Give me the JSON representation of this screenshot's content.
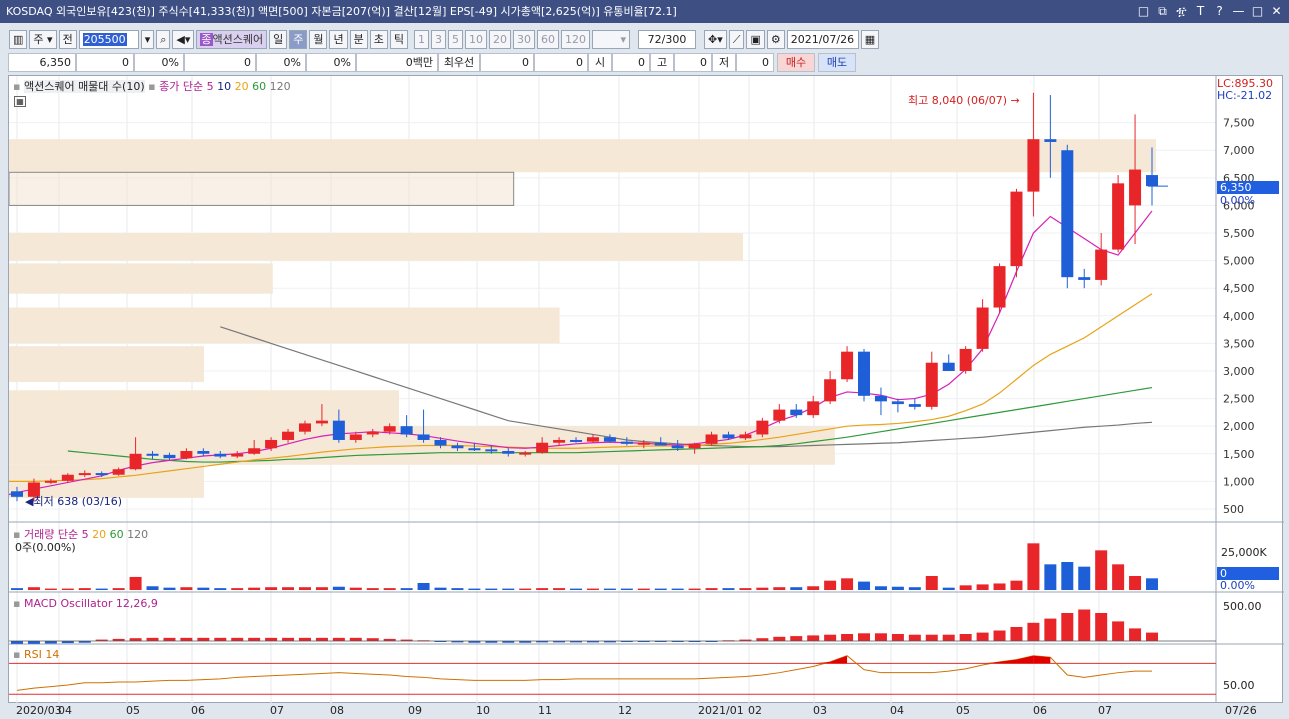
{
  "title": "KOSDAQ 외국인보유[423(천)] 주식수[41,333(천)] 액면[500] 자본금[207(억)] 결산[12월] EPS[-49] 시가총액[2,625(억)] 유통비율[72.1]",
  "window_icons": [
    "□",
    "⧉",
    "፹",
    "T",
    "?",
    "—",
    "□",
    "✕"
  ],
  "toolbar": {
    "period": "주",
    "prev": "전",
    "code": "205500",
    "name": "액션스퀘어",
    "name_icon": "종",
    "periods": [
      "일",
      "주",
      "월",
      "년",
      "분",
      "초",
      "틱"
    ],
    "selected_period": "주",
    "intervals": [
      "1",
      "3",
      "5",
      "10",
      "20",
      "30",
      "60",
      "120"
    ],
    "count": "72",
    "count_total": "/300",
    "date": "2021/07/26"
  },
  "quote": {
    "price": "6,350",
    "v1": "0",
    "p1": "0%",
    "v2": "0",
    "p2": "0%",
    "p3": "0%",
    "amount": "0백만",
    "best_label": "최우선",
    "b1": "0",
    "b2": "0",
    "open_label": "시",
    "open": "0",
    "high_label": "고",
    "high": "0",
    "low_label": "저",
    "low": "0",
    "buy": "매수",
    "sell": "매도"
  },
  "main_panel": {
    "legend_vp": "액션스퀘어 매물대 수(10)",
    "legend_ma_prefix": "종가 단순",
    "ma_periods": [
      "5",
      "10",
      "20",
      "60",
      "120"
    ],
    "lc": "LC:895.30",
    "hc": "HC:-21.02",
    "high_annot": "최고 8,040 (06/07)",
    "low_annot": "최저 638 (03/16)",
    "price_ticks": [
      "7,500",
      "7,000",
      "6,500",
      "6,000",
      "5,500",
      "5,000",
      "4,500",
      "4,000",
      "3,500",
      "3,000",
      "2,500",
      "2,000",
      "1,500",
      "1,000",
      "500"
    ],
    "current_price": "6,350",
    "current_pct": "0.00%"
  },
  "volume_panel": {
    "legend_prefix": "거래량 단순",
    "ma_periods": [
      "5",
      "20",
      "60",
      "120"
    ],
    "info": "0주(0.00%)",
    "tick": "25,000K",
    "cur": "0",
    "cur_pct": "0.00%"
  },
  "macd_panel": {
    "legend": "MACD Oscillator 12,26,9",
    "tick": "500.00"
  },
  "rsi_panel": {
    "legend": "RSI 14",
    "tick": "50.00"
  },
  "x_axis": {
    "labels": [
      "2020/03",
      "04",
      "05",
      "06",
      "07",
      "08",
      "09",
      "10",
      "11",
      "12",
      "2021/01",
      "02",
      "03",
      "04",
      "05",
      "06",
      "07"
    ],
    "end_label": "07/26"
  },
  "colors": {
    "up": "#e8262a",
    "down": "#1e5fd8",
    "ma5": "#d81fb8",
    "ma10": "#1a237e",
    "ma20": "#e8a316",
    "ma60": "#2e9a3a",
    "ma120": "#777777",
    "vp": "#f5e8d7"
  },
  "chart_data": {
    "type": "candlestick",
    "x": [
      "2020/03",
      "04",
      "05",
      "06",
      "07",
      "08",
      "09",
      "10",
      "11",
      "12",
      "2021/01",
      "02",
      "03",
      "04",
      "05",
      "06",
      "07"
    ],
    "ylim": [
      300,
      8200
    ],
    "candles": [
      [
        820,
        900,
        640,
        720
      ],
      [
        720,
        1050,
        638,
        980
      ],
      [
        980,
        1050,
        950,
        1010
      ],
      [
        1010,
        1150,
        980,
        1120
      ],
      [
        1120,
        1200,
        1080,
        1150
      ],
      [
        1150,
        1180,
        1080,
        1120
      ],
      [
        1120,
        1250,
        1100,
        1220
      ],
      [
        1220,
        1800,
        1200,
        1500
      ],
      [
        1500,
        1550,
        1400,
        1480
      ],
      [
        1480,
        1520,
        1380,
        1420
      ],
      [
        1420,
        1600,
        1400,
        1550
      ],
      [
        1550,
        1600,
        1450,
        1500
      ],
      [
        1500,
        1550,
        1420,
        1450
      ],
      [
        1450,
        1550,
        1420,
        1500
      ],
      [
        1500,
        1750,
        1480,
        1600
      ],
      [
        1600,
        1800,
        1550,
        1750
      ],
      [
        1750,
        1950,
        1700,
        1900
      ],
      [
        1900,
        2100,
        1850,
        2050
      ],
      [
        2050,
        2400,
        2000,
        2100
      ],
      [
        2100,
        2300,
        1700,
        1750
      ],
      [
        1750,
        1900,
        1700,
        1850
      ],
      [
        1850,
        1950,
        1800,
        1900
      ],
      [
        1900,
        2050,
        1850,
        2000
      ],
      [
        2000,
        2200,
        1800,
        1850
      ],
      [
        1850,
        2300,
        1700,
        1750
      ],
      [
        1750,
        1800,
        1600,
        1650
      ],
      [
        1650,
        1700,
        1550,
        1600
      ],
      [
        1600,
        1700,
        1550,
        1580
      ],
      [
        1580,
        1650,
        1500,
        1550
      ],
      [
        1550,
        1600,
        1450,
        1500
      ],
      [
        1500,
        1550,
        1450,
        1520
      ],
      [
        1520,
        1800,
        1500,
        1700
      ],
      [
        1700,
        1800,
        1650,
        1750
      ],
      [
        1750,
        1800,
        1700,
        1720
      ],
      [
        1720,
        1850,
        1700,
        1800
      ],
      [
        1800,
        1850,
        1700,
        1720
      ],
      [
        1720,
        1800,
        1650,
        1680
      ],
      [
        1680,
        1750,
        1600,
        1700
      ],
      [
        1700,
        1800,
        1650,
        1650
      ],
      [
        1650,
        1750,
        1550,
        1600
      ],
      [
        1600,
        1700,
        1500,
        1680
      ],
      [
        1680,
        1900,
        1650,
        1850
      ],
      [
        1850,
        1900,
        1750,
        1780
      ],
      [
        1780,
        1900,
        1750,
        1850
      ],
      [
        1850,
        2150,
        1800,
        2100
      ],
      [
        2100,
        2400,
        2050,
        2300
      ],
      [
        2300,
        2400,
        2150,
        2200
      ],
      [
        2200,
        2550,
        2150,
        2450
      ],
      [
        2450,
        3000,
        2400,
        2850
      ],
      [
        2850,
        3450,
        2800,
        3350
      ],
      [
        3350,
        3400,
        2450,
        2550
      ],
      [
        2550,
        2700,
        2200,
        2450
      ],
      [
        2450,
        2500,
        2250,
        2400
      ],
      [
        2400,
        2500,
        2300,
        2350
      ],
      [
        2350,
        3350,
        2300,
        3150
      ],
      [
        3150,
        3300,
        3000,
        3000
      ],
      [
        3000,
        3450,
        2950,
        3400
      ],
      [
        3400,
        4300,
        3350,
        4150
      ],
      [
        4150,
        4950,
        4050,
        4900
      ],
      [
        4900,
        6300,
        4700,
        6250
      ],
      [
        6250,
        8040,
        5800,
        7200
      ],
      [
        7200,
        8000,
        6500,
        7150
      ],
      [
        7000,
        7100,
        4500,
        4700
      ],
      [
        4700,
        4850,
        4500,
        4650
      ],
      [
        4650,
        5500,
        4550,
        5200
      ],
      [
        5200,
        6550,
        5150,
        6400
      ],
      [
        6000,
        7650,
        5300,
        6650
      ],
      [
        6550,
        7050,
        6000,
        6350
      ]
    ],
    "ma5": [
      720,
      800,
      860,
      920,
      980,
      1040,
      1100,
      1200,
      1280,
      1340,
      1380,
      1420,
      1460,
      1480,
      1500,
      1540,
      1600,
      1680,
      1760,
      1820,
      1860,
      1880,
      1900,
      1880,
      1860,
      1830,
      1780,
      1730,
      1690,
      1650,
      1610,
      1600,
      1620,
      1650,
      1680,
      1700,
      1710,
      1700,
      1690,
      1670,
      1660,
      1680,
      1720,
      1760,
      1840,
      1960,
      2100,
      2200,
      2340,
      2520,
      2620,
      2600,
      2560,
      2480,
      2500,
      2580,
      2760,
      3030,
      3400,
      4050,
      4800,
      5500,
      5800,
      5600,
      5400,
      5200,
      5100,
      5500,
      5900
    ],
    "ma20": [
      1000,
      1000,
      1000,
      1010,
      1020,
      1030,
      1050,
      1080,
      1110,
      1150,
      1190,
      1230,
      1270,
      1310,
      1350,
      1390,
      1420,
      1450,
      1490,
      1530,
      1560,
      1590,
      1610,
      1630,
      1640,
      1650,
      1650,
      1650,
      1640,
      1630,
      1620,
      1610,
      1600,
      1600,
      1600,
      1610,
      1620,
      1630,
      1640,
      1640,
      1640,
      1650,
      1670,
      1690,
      1720,
      1760,
      1800,
      1850,
      1900,
      1950,
      2000,
      2020,
      2030,
      2050,
      2080,
      2120,
      2180,
      2280,
      2400,
      2600,
      2850,
      3100,
      3300,
      3450,
      3600,
      3800,
      4000,
      4200,
      4400
    ],
    "ma60": [
      1550,
      1520,
      1490,
      1460,
      1430,
      1400,
      1380,
      1360,
      1350,
      1350,
      1360,
      1370,
      1380,
      1400,
      1410,
      1430,
      1450,
      1470,
      1480,
      1490,
      1500,
      1510,
      1520,
      1520,
      1520,
      1520,
      1520,
      1520,
      1520,
      1520,
      1520,
      1530,
      1540,
      1550,
      1560,
      1570,
      1580,
      1590,
      1600,
      1610,
      1620,
      1630,
      1650,
      1680,
      1720,
      1760,
      1800,
      1850,
      1900,
      1950,
      2000,
      2050,
      2100,
      2150,
      2200,
      2250,
      2300,
      2350,
      2400,
      2450,
      2500,
      2550,
      2600,
      2650,
      2700
    ],
    "ma120": [
      3800,
      3700,
      3600,
      3500,
      3400,
      3300,
      3200,
      3100,
      3000,
      2900,
      2800,
      2700,
      2600,
      2500,
      2400,
      2300,
      2200,
      2100,
      2050,
      2000,
      1950,
      1900,
      1850,
      1800,
      1750,
      1720,
      1700,
      1680,
      1660,
      1650,
      1640,
      1630,
      1630,
      1630,
      1640,
      1650,
      1660,
      1670,
      1680,
      1690,
      1700,
      1720,
      1740,
      1760,
      1780,
      1800,
      1830,
      1860,
      1890,
      1920,
      1950,
      1980,
      2000,
      2020,
      2050,
      2070
    ],
    "volume_profile": [
      {
        "lo": 6600,
        "hi": 7200,
        "len": 1.0
      },
      {
        "lo": 6000,
        "hi": 6600,
        "len": 0.44
      },
      {
        "lo": 5000,
        "hi": 5500,
        "len": 0.64
      },
      {
        "lo": 4400,
        "hi": 4950,
        "len": 0.23
      },
      {
        "lo": 3500,
        "hi": 4150,
        "len": 0.48
      },
      {
        "lo": 2800,
        "hi": 3450,
        "len": 0.17
      },
      {
        "lo": 2000,
        "hi": 2650,
        "len": 0.34
      },
      {
        "lo": 1300,
        "hi": 2000,
        "len": 0.72
      },
      {
        "lo": 700,
        "hi": 1300,
        "len": 0.17
      }
    ],
    "volume": [
      0.04,
      0.06,
      0.03,
      0.03,
      0.04,
      0.03,
      0.04,
      0.28,
      0.08,
      0.05,
      0.06,
      0.05,
      0.04,
      0.04,
      0.05,
      0.06,
      0.06,
      0.06,
      0.06,
      0.07,
      0.05,
      0.04,
      0.04,
      0.04,
      0.15,
      0.05,
      0.04,
      0.03,
      0.03,
      0.03,
      0.03,
      0.04,
      0.04,
      0.03,
      0.03,
      0.03,
      0.03,
      0.03,
      0.03,
      0.03,
      0.03,
      0.04,
      0.04,
      0.04,
      0.05,
      0.06,
      0.06,
      0.08,
      0.2,
      0.25,
      0.18,
      0.08,
      0.07,
      0.06,
      0.3,
      0.05,
      0.1,
      0.12,
      0.14,
      0.2,
      1.0,
      0.55,
      0.6,
      0.5,
      0.85,
      0.55,
      0.3,
      0.25,
      0.45,
      1.2,
      0.25
    ],
    "macd": [
      -40,
      -40,
      -35,
      -30,
      -25,
      20,
      30,
      40,
      45,
      45,
      45,
      45,
      45,
      45,
      45,
      45,
      45,
      45,
      45,
      45,
      45,
      40,
      30,
      20,
      10,
      -10,
      -20,
      -25,
      -25,
      -25,
      -25,
      -20,
      -20,
      -20,
      -20,
      -20,
      -15,
      -15,
      -10,
      -10,
      -10,
      -5,
      10,
      20,
      40,
      60,
      70,
      80,
      90,
      100,
      110,
      110,
      100,
      90,
      90,
      90,
      100,
      120,
      150,
      200,
      260,
      320,
      400,
      450,
      400,
      280,
      180,
      120,
      150,
      160,
      130,
      100
    ],
    "rsi": [
      35,
      38,
      40,
      42,
      45,
      45,
      46,
      46,
      47,
      48,
      48,
      49,
      50,
      52,
      53,
      54,
      55,
      56,
      57,
      58,
      57,
      56,
      55,
      53,
      52,
      50,
      49,
      48,
      48,
      48,
      48,
      49,
      49,
      50,
      50,
      50,
      50,
      50,
      50,
      50,
      50,
      51,
      52,
      53,
      55,
      58,
      62,
      66,
      72,
      80,
      62,
      58,
      58,
      58,
      58,
      60,
      63,
      68,
      72,
      75,
      80,
      78,
      55,
      52,
      55,
      58,
      60,
      60,
      59,
      59
    ]
  }
}
